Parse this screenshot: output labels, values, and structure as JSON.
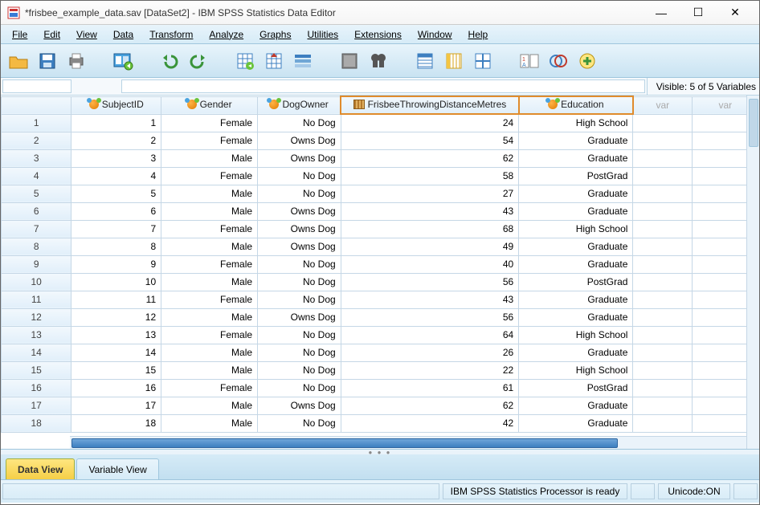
{
  "window": {
    "title": "*frisbee_example_data.sav [DataSet2] - IBM SPSS Statistics Data Editor"
  },
  "menu": {
    "file": "File",
    "edit": "Edit",
    "view": "View",
    "data": "Data",
    "transform": "Transform",
    "analyze": "Analyze",
    "graphs": "Graphs",
    "utilities": "Utilities",
    "extensions": "Extensions",
    "window": "Window",
    "help": "Help"
  },
  "info": {
    "visible": "Visible: 5 of 5 Variables"
  },
  "columns": [
    {
      "name": "SubjectID",
      "type": "nominal",
      "hl": false,
      "align": "right"
    },
    {
      "name": "Gender",
      "type": "nominal",
      "hl": false,
      "align": "right"
    },
    {
      "name": "DogOwner",
      "type": "nominal",
      "hl": false,
      "align": "right"
    },
    {
      "name": "FrisbeeThrowingDistanceMetres",
      "type": "scale",
      "hl": true,
      "align": "right"
    },
    {
      "name": "Education",
      "type": "nominal",
      "hl": true,
      "align": "right"
    },
    {
      "name": "var",
      "type": "empty",
      "hl": false,
      "align": "center"
    },
    {
      "name": "var",
      "type": "empty",
      "hl": false,
      "align": "center"
    }
  ],
  "rows": [
    {
      "n": "1",
      "SubjectID": "1",
      "Gender": "Female",
      "DogOwner": "No Dog",
      "FrisbeeThrowingDistanceMetres": "24",
      "Education": "High School"
    },
    {
      "n": "2",
      "SubjectID": "2",
      "Gender": "Female",
      "DogOwner": "Owns Dog",
      "FrisbeeThrowingDistanceMetres": "54",
      "Education": "Graduate"
    },
    {
      "n": "3",
      "SubjectID": "3",
      "Gender": "Male",
      "DogOwner": "Owns Dog",
      "FrisbeeThrowingDistanceMetres": "62",
      "Education": "Graduate"
    },
    {
      "n": "4",
      "SubjectID": "4",
      "Gender": "Female",
      "DogOwner": "No Dog",
      "FrisbeeThrowingDistanceMetres": "58",
      "Education": "PostGrad"
    },
    {
      "n": "5",
      "SubjectID": "5",
      "Gender": "Male",
      "DogOwner": "No Dog",
      "FrisbeeThrowingDistanceMetres": "27",
      "Education": "Graduate"
    },
    {
      "n": "6",
      "SubjectID": "6",
      "Gender": "Male",
      "DogOwner": "Owns Dog",
      "FrisbeeThrowingDistanceMetres": "43",
      "Education": "Graduate"
    },
    {
      "n": "7",
      "SubjectID": "7",
      "Gender": "Female",
      "DogOwner": "Owns Dog",
      "FrisbeeThrowingDistanceMetres": "68",
      "Education": "High School"
    },
    {
      "n": "8",
      "SubjectID": "8",
      "Gender": "Male",
      "DogOwner": "Owns Dog",
      "FrisbeeThrowingDistanceMetres": "49",
      "Education": "Graduate"
    },
    {
      "n": "9",
      "SubjectID": "9",
      "Gender": "Female",
      "DogOwner": "No Dog",
      "FrisbeeThrowingDistanceMetres": "40",
      "Education": "Graduate"
    },
    {
      "n": "10",
      "SubjectID": "10",
      "Gender": "Male",
      "DogOwner": "No Dog",
      "FrisbeeThrowingDistanceMetres": "56",
      "Education": "PostGrad"
    },
    {
      "n": "11",
      "SubjectID": "11",
      "Gender": "Female",
      "DogOwner": "No Dog",
      "FrisbeeThrowingDistanceMetres": "43",
      "Education": "Graduate"
    },
    {
      "n": "12",
      "SubjectID": "12",
      "Gender": "Male",
      "DogOwner": "Owns Dog",
      "FrisbeeThrowingDistanceMetres": "56",
      "Education": "Graduate"
    },
    {
      "n": "13",
      "SubjectID": "13",
      "Gender": "Female",
      "DogOwner": "No Dog",
      "FrisbeeThrowingDistanceMetres": "64",
      "Education": "High School"
    },
    {
      "n": "14",
      "SubjectID": "14",
      "Gender": "Male",
      "DogOwner": "No Dog",
      "FrisbeeThrowingDistanceMetres": "26",
      "Education": "Graduate"
    },
    {
      "n": "15",
      "SubjectID": "15",
      "Gender": "Male",
      "DogOwner": "No Dog",
      "FrisbeeThrowingDistanceMetres": "22",
      "Education": "High School"
    },
    {
      "n": "16",
      "SubjectID": "16",
      "Gender": "Female",
      "DogOwner": "No Dog",
      "FrisbeeThrowingDistanceMetres": "61",
      "Education": "PostGrad"
    },
    {
      "n": "17",
      "SubjectID": "17",
      "Gender": "Male",
      "DogOwner": "Owns Dog",
      "FrisbeeThrowingDistanceMetres": "62",
      "Education": "Graduate"
    },
    {
      "n": "18",
      "SubjectID": "18",
      "Gender": "Male",
      "DogOwner": "No Dog",
      "FrisbeeThrowingDistanceMetres": "42",
      "Education": "Graduate"
    }
  ],
  "tabs": {
    "data": "Data View",
    "variable": "Variable View"
  },
  "status": {
    "processor": "IBM SPSS Statistics Processor is ready",
    "unicode": "Unicode:ON"
  }
}
